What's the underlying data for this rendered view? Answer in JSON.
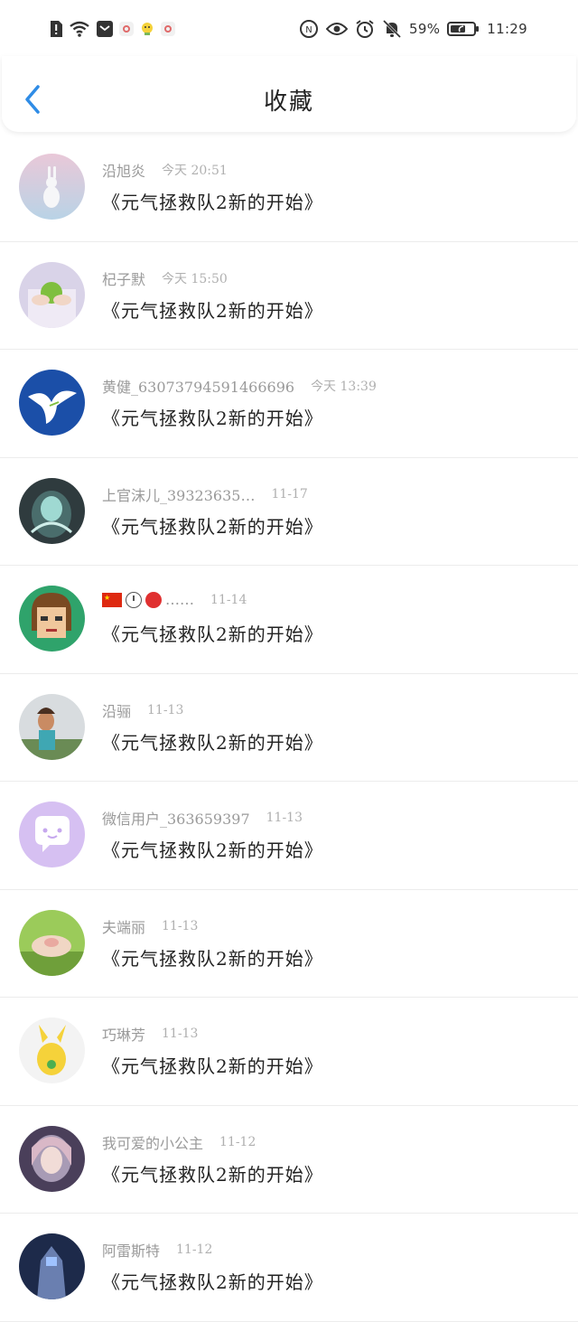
{
  "status_bar": {
    "battery": "59%",
    "time": "11:29"
  },
  "header": {
    "title": "收藏"
  },
  "favorites": [
    {
      "user": "沿旭炎",
      "time": "今天 20:51",
      "message": "《元气拯救队2新的开始》",
      "avatar_colors": [
        "#e9c8d8",
        "#b9d3e6"
      ]
    },
    {
      "user": "杞子默",
      "time": "今天 15:50",
      "message": "《元气拯救队2新的开始》",
      "avatar_colors": [
        "#d9d3e8",
        "#7fbf3f"
      ]
    },
    {
      "user": "黄健_63073794591466696",
      "time": "今天 13:39",
      "message": "《元气拯救队2新的开始》",
      "avatar_colors": [
        "#1b4fa8",
        "#ffffff"
      ]
    },
    {
      "user": "上官沫儿_39323635…",
      "time": "11-17",
      "message": "《元气拯救队2新的开始》",
      "avatar_colors": [
        "#2f3b3e",
        "#9fd9d2"
      ]
    },
    {
      "user": "",
      "time": "11-14",
      "message": "《元气拯救队2新的开始》",
      "avatar_colors": [
        "#2fa36b",
        "#7a4a22"
      ],
      "name_emojis": [
        "flag-china",
        "clock",
        "ping-pong"
      ],
      "name_suffix": "……"
    },
    {
      "user": "沿骊",
      "time": "11-13",
      "message": "《元气拯救队2新的开始》",
      "avatar_colors": [
        "#d8dcdf",
        "#6a8b55"
      ]
    },
    {
      "user": "微信用户_363659397",
      "time": "11-13",
      "message": "《元气拯救队2新的开始》",
      "avatar_colors": [
        "#d6c0f2",
        "#ffffff"
      ]
    },
    {
      "user": "夫端丽",
      "time": "11-13",
      "message": "《元气拯救队2新的开始》",
      "avatar_colors": [
        "#9bcb5a",
        "#f0d6c4"
      ]
    },
    {
      "user": "巧琳芳",
      "time": "11-13",
      "message": "《元气拯救队2新的开始》",
      "avatar_colors": [
        "#f3f3f3",
        "#f5d23a"
      ]
    },
    {
      "user": "我可爱的小公主",
      "time": "11-12",
      "message": "《元气拯救队2新的开始》",
      "avatar_colors": [
        "#4a3f5a",
        "#d9b8c7"
      ]
    },
    {
      "user": "阿雷斯特",
      "time": "11-12",
      "message": "《元气拯救队2新的开始》",
      "avatar_colors": [
        "#1d2a4a",
        "#6a7fb0"
      ]
    }
  ],
  "colors": {
    "accent": "#2f8ce6",
    "title": "#222222",
    "meta": "#9a9a9a",
    "divider": "#ececec"
  }
}
